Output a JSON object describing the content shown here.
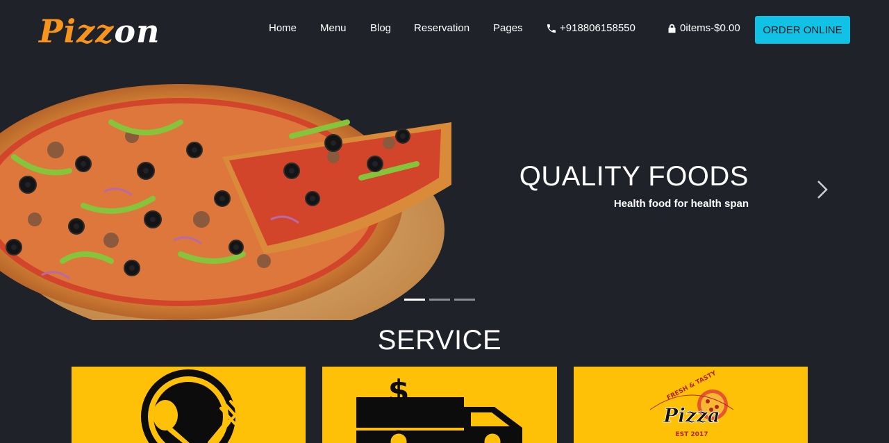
{
  "brand": {
    "logo_part1": "Pizz",
    "logo_part2": "on",
    "accent": "#f7941d"
  },
  "nav": {
    "links": [
      "Home",
      "Menu",
      "Blog",
      "Reservation",
      "Pages"
    ],
    "phone_icon": "phone-icon",
    "phone": "+918806158550",
    "cart_icon": "lock-icon",
    "cart": "0items-$0.00",
    "order_label": "ORDER ONLINE",
    "order_color": "#0fc2e6"
  },
  "hero": {
    "title": "QUALITY FOODS",
    "subtitle": "Health food for health span",
    "next_icon": "chevron-right-icon",
    "slides_total": 3,
    "active_slide": 1
  },
  "service": {
    "title": "SERVICE",
    "card_color": "#ffc107",
    "cards": [
      {
        "icon": "dining-plate-icon"
      },
      {
        "icon": "delivery-truck-icon"
      },
      {
        "icon": "pizza-logo-icon",
        "badge_top": "FRESH & TASTY",
        "badge_word": "Pizza",
        "badge_bottom": "EST 2017"
      }
    ]
  }
}
